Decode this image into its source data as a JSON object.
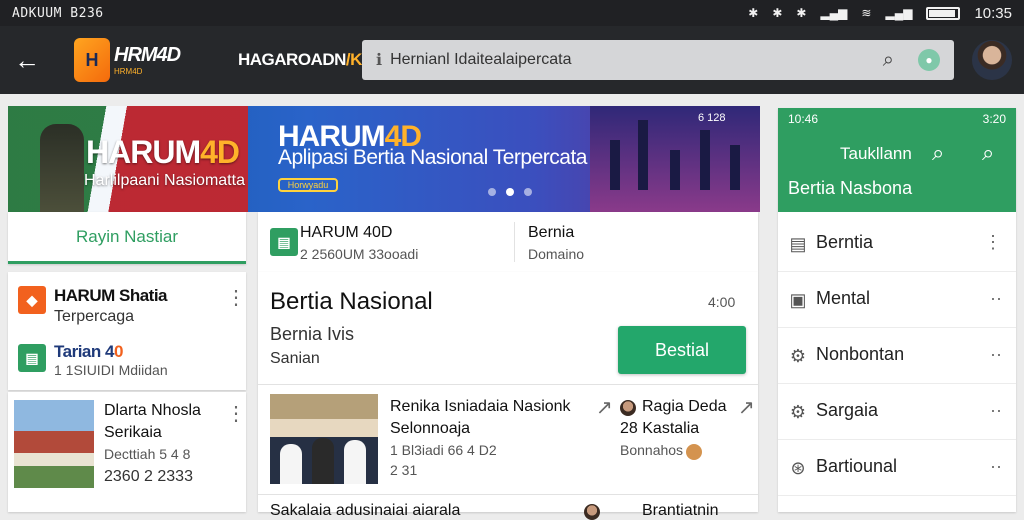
{
  "status_bar": {
    "left_text": "ADKUUM B236",
    "time": "10:35",
    "battery_level": 0.9,
    "icons": [
      "bluetooth-icon",
      "bluetooth-icon",
      "bluetooth-icon",
      "signal-icon",
      "wifi-icon",
      "signal-icon",
      "battery-icon"
    ]
  },
  "app_bar": {
    "back_icon": "arrow-left-icon",
    "logo_primary": "HRM4D",
    "logo_secondary": "HRM4D",
    "app_name_main": "HAGAROADN",
    "app_name_accent": "/K",
    "search": {
      "placeholder": "Hernianl Idaitealaipercata",
      "value": "Hernianl Idaitealaipercata",
      "search_icon": "search-icon",
      "mic_icon": "mic-icon"
    },
    "avatar": "user-avatar"
  },
  "banner": {
    "title_main": "HARUM",
    "title_accent": "4D",
    "left_subtitle": "Harlilpaani Nasiomatta",
    "title2_main": "HARUM",
    "title2_accent": "4D",
    "subtitle": "Aplipasi Bertia Nasional Terpercata",
    "badge": "Horwyadu",
    "date": "6 128",
    "dots": 3,
    "active_dot": 1
  },
  "left_column": {
    "tab_label": "Rayin Nastiar",
    "item1": {
      "title": "HARUM Shatia",
      "sub": "Terpercaga",
      "icon": "shield-icon"
    },
    "item2": {
      "title": "Tarian 4",
      "title_accent": "0",
      "sub": "1 1SIUIDI Mdiidan",
      "icon": "news-icon"
    },
    "item3": {
      "title": "Dlarta Nhosla",
      "sub": "Serikaia",
      "meta1": "Decttiah 5 4 8",
      "meta2": "2360 2 2333"
    }
  },
  "middle": {
    "top_left_title": "HARUM 40D",
    "top_left_sub": "2 2560UM 33ooadi",
    "top_right_title": "Bernia",
    "top_right_sub": "Domaino",
    "main_title": "Bertia Nasional",
    "main_value": "4:00",
    "main_sub1": "Bernia Ivis",
    "main_sub2": "Sanian",
    "button": "Bestial",
    "news1_title": "Renika Isniadaia Nasionk",
    "news1_sub": "Selonnoaja",
    "news1_meta1": "1 Bl3iadi 66 4 D2",
    "news1_meta2": "2 31",
    "news2_title": "Ragia Deda",
    "news2_sub": "28 Kastalia",
    "news2_meta": "Bonnahos",
    "bottom_left": "Sakalaia adusinaiai aiarala",
    "bottom_right": "Brantiatnin"
  },
  "right_panel": {
    "time": "10:46",
    "right_status": "3:20",
    "title": "Taukllann",
    "search_icon": "search-icon",
    "subtitle": "Bertia Nasbona",
    "items": [
      {
        "label": "Berntia",
        "icon": "news-icon"
      },
      {
        "label": "Mental",
        "icon": "bookmark-icon"
      },
      {
        "label": "Nonbontan",
        "icon": "gear-icon"
      },
      {
        "label": "Sargaia",
        "icon": "gear-icon"
      },
      {
        "label": "Bartiounal",
        "icon": "info-icon"
      }
    ]
  },
  "colors": {
    "accent_green": "#2f9e61",
    "button_green": "#23a76b",
    "app_bar": "#26282b",
    "accent_orange": "#ffb22a"
  }
}
